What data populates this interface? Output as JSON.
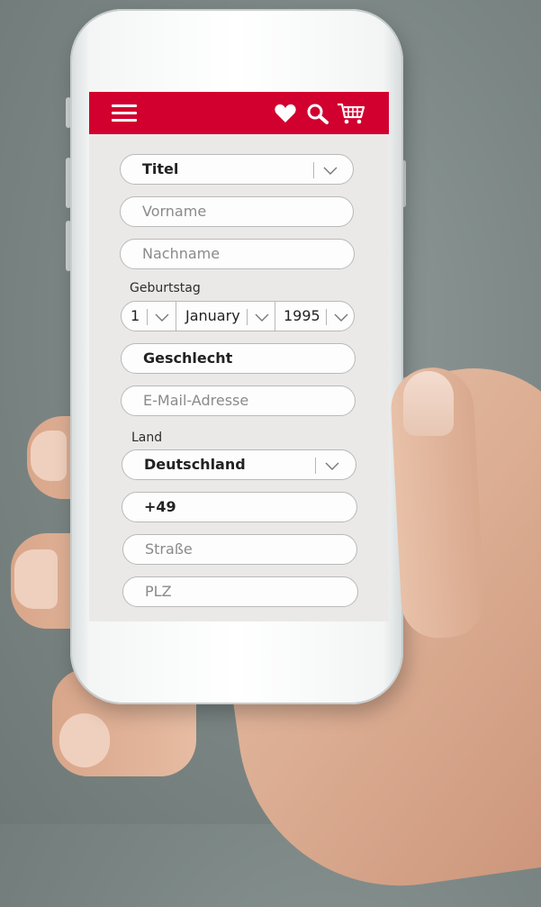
{
  "header": {
    "icons": [
      "menu-icon",
      "heart-icon",
      "search-icon",
      "cart-icon"
    ],
    "brand_color": "#d1002f"
  },
  "form": {
    "title_select": {
      "value": "Titel"
    },
    "first_name": {
      "placeholder": "Vorname"
    },
    "last_name": {
      "placeholder": "Nachname"
    },
    "birthday": {
      "label": "Geburtstag",
      "day": "1",
      "month": "January",
      "year": "1995"
    },
    "gender": {
      "value": "Geschlecht"
    },
    "email": {
      "placeholder": "E-Mail-Adresse"
    },
    "country": {
      "label": "Land",
      "value": "Deutschland"
    },
    "phone_prefix": {
      "value": "+49"
    },
    "street": {
      "placeholder": "Straße"
    },
    "zip": {
      "placeholder": "PLZ"
    }
  }
}
